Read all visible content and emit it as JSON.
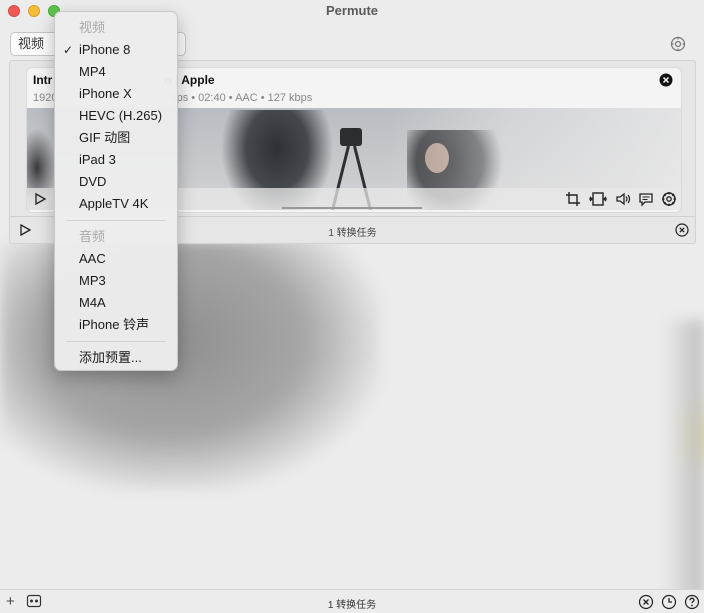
{
  "app": {
    "title": "Permute"
  },
  "toolbar": {
    "tab_label": "视频"
  },
  "job": {
    "title_left": "Intr",
    "title_right": "o | Apple",
    "meta_left": "1920",
    "meta_right": "bps • 02:40 • AAC • 127 kbps"
  },
  "queue": {
    "status": "1 转换任务"
  },
  "bottom": {
    "status": "1 转换任务",
    "add_label": "+"
  },
  "menu": {
    "video_header": "视频",
    "video_items": [
      "iPhone 8",
      "MP4",
      "iPhone X",
      "HEVC (H.265)",
      "GIF 动图",
      "iPad 3",
      "DVD",
      "AppleTV 4K"
    ],
    "selected": "iPhone 8",
    "check": "✓",
    "audio_header": "音频",
    "audio_items": [
      "AAC",
      "MP3",
      "M4A",
      "iPhone 铃声"
    ],
    "add_preset": "添加预置..."
  },
  "colors": {
    "close": "#ee5b55",
    "minimize": "#f5bd3b",
    "maximize": "#5fc549"
  },
  "icons": [
    "settings-icon",
    "close-circle-icon",
    "play-icon",
    "crop-icon",
    "film-icon",
    "speaker-icon",
    "subtitle-icon",
    "gear-icon",
    "plus-icon",
    "media-icon",
    "history-icon",
    "help-icon"
  ]
}
